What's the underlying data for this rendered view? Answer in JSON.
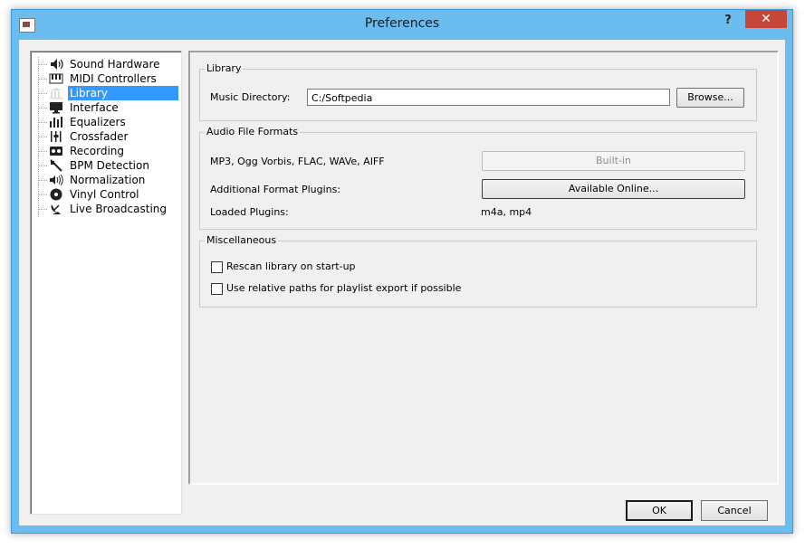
{
  "window": {
    "title": "Preferences",
    "help_label": "?",
    "close_label": "✕"
  },
  "sidebar": {
    "items": [
      {
        "label": "Sound Hardware",
        "icon": "speaker-icon"
      },
      {
        "label": "MIDI Controllers",
        "icon": "keyboard-icon"
      },
      {
        "label": "Library",
        "icon": "library-icon",
        "selected": true
      },
      {
        "label": "Interface",
        "icon": "monitor-icon"
      },
      {
        "label": "Equalizers",
        "icon": "equalizer-icon"
      },
      {
        "label": "Crossfader",
        "icon": "crossfader-icon"
      },
      {
        "label": "Recording",
        "icon": "tape-icon"
      },
      {
        "label": "BPM Detection",
        "icon": "metronome-icon"
      },
      {
        "label": "Normalization",
        "icon": "volume-waves-icon"
      },
      {
        "label": "Vinyl Control",
        "icon": "vinyl-icon"
      },
      {
        "label": "Live Broadcasting",
        "icon": "satellite-dish-icon"
      }
    ]
  },
  "library_group": {
    "title": "Library",
    "music_directory_label": "Music Directory:",
    "music_directory_value": "C:/Softpedia",
    "browse_label": "Browse..."
  },
  "formats_group": {
    "title": "Audio File Formats",
    "builtin_formats_label": "MP3, Ogg Vorbis, FLAC, WAVe, AIFF",
    "builtin_button": "Built-in",
    "plugins_label": "Additional Format Plugins:",
    "available_online_button": "Available Online...",
    "loaded_plugins_label": "Loaded Plugins:",
    "loaded_plugins_value": "m4a, mp4"
  },
  "misc_group": {
    "title": "Miscellaneous",
    "rescan_label": "Rescan library on start-up",
    "rescan_checked": false,
    "relative_paths_label": "Use relative paths for playlist export if possible",
    "relative_paths_checked": false
  },
  "footer": {
    "ok_label": "OK",
    "cancel_label": "Cancel"
  },
  "colors": {
    "frame": "#6bbdf0",
    "close": "#c7463a",
    "selection": "#3399ff",
    "dialog": "#f0f0f0"
  }
}
